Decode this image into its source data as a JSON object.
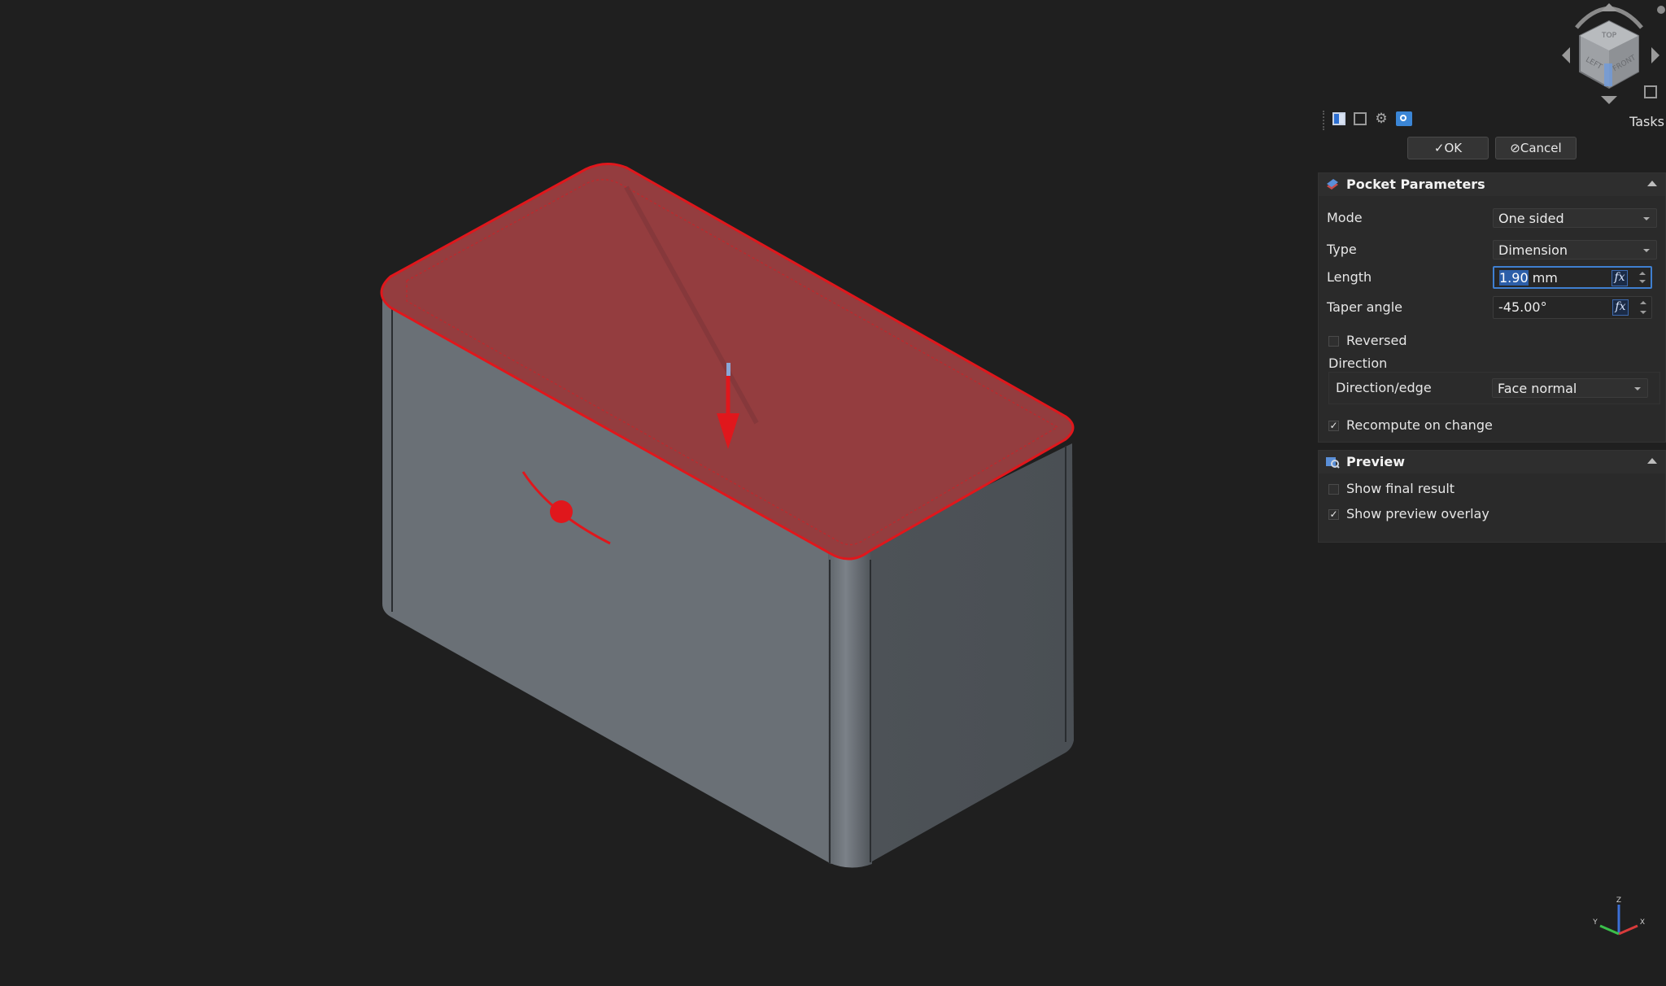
{
  "panel": {
    "tasks_label": "Tasks",
    "ok_label": "OK",
    "cancel_label": "Cancel",
    "ok_icon": "check-icon",
    "cancel_icon": "cancel-circle-icon"
  },
  "pocket": {
    "title": "Pocket Parameters",
    "mode": {
      "label": "Mode",
      "value": "One sided"
    },
    "type": {
      "label": "Type",
      "value": "Dimension"
    },
    "length": {
      "label": "Length",
      "value_selected": "1.90",
      "unit": " mm"
    },
    "taper": {
      "label": "Taper angle",
      "value": "-45.00°"
    },
    "reversed": {
      "label": "Reversed",
      "checked": false
    },
    "direction": {
      "heading": "Direction",
      "label": "Direction/edge",
      "value": "Face normal"
    },
    "recompute": {
      "label": "Recompute on change",
      "checked": true
    }
  },
  "preview": {
    "title": "Preview",
    "show_final": {
      "label": "Show final result",
      "checked": false
    },
    "show_overlay": {
      "label": "Show preview overlay",
      "checked": true
    }
  },
  "navcube": {
    "top": "TOP",
    "left": "LEFT",
    "front": "FRONT"
  },
  "axis": {
    "x": "X",
    "y": "Y",
    "z": "Z"
  },
  "colors": {
    "highlight": "#e0171c",
    "accent": "#3f7fd0",
    "background": "#1f1f1f"
  }
}
